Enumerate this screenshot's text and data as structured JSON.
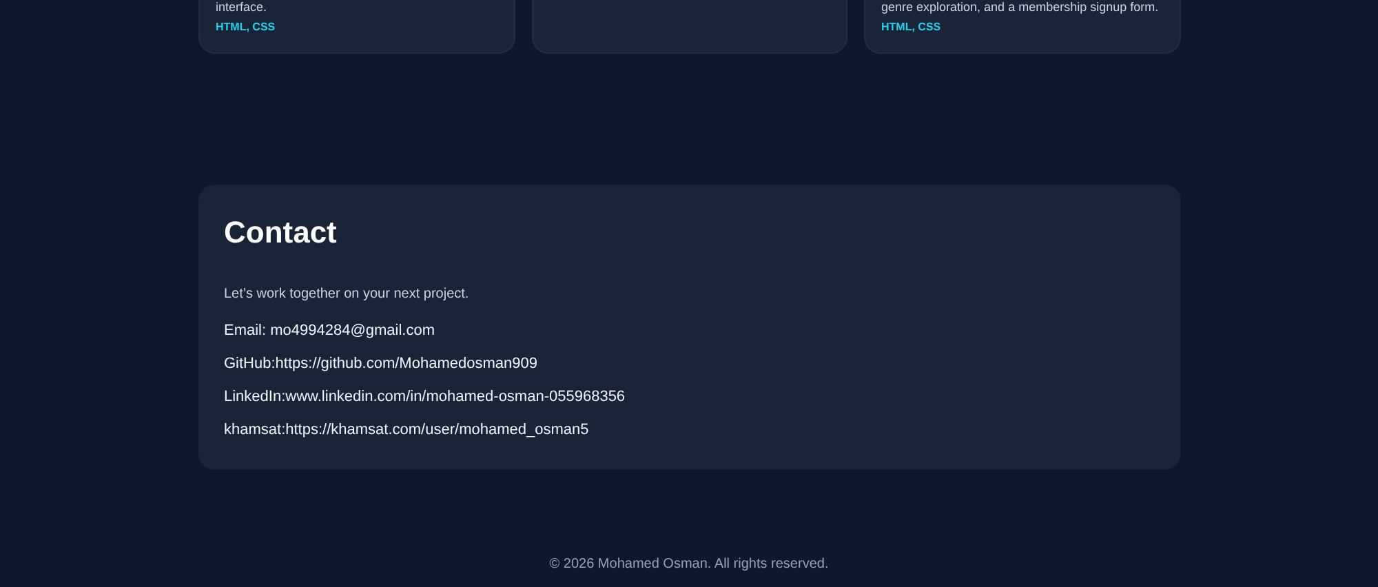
{
  "projects": [
    {
      "kind": "text",
      "description": "interface.",
      "tags": "HTML, CSS"
    },
    {
      "kind": "empty"
    },
    {
      "kind": "text",
      "description": "genre exploration, and a membership signup form.",
      "tags": "HTML, CSS"
    }
  ],
  "contact": {
    "title": "Contact",
    "intro": "Let’s work together on your next project.",
    "lines": [
      "Email: mo4994284@gmail.com",
      "GitHub:https://github.com/Mohamedosman909",
      "LinkedIn:www.linkedin.com/in/mohamed-osman-055968356",
      "khamsat:https://khamsat.com/user/mohamed_osman5"
    ]
  },
  "footer": "© 2026 Mohamed Osman. All rights reserved."
}
